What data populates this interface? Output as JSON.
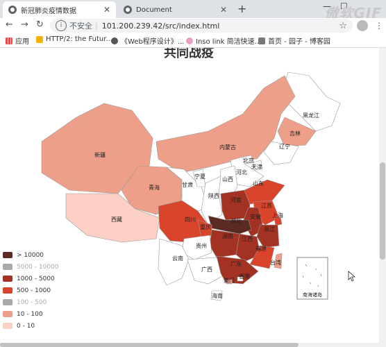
{
  "browser": {
    "tabs": [
      {
        "title": "新冠肺炎疫情数据",
        "active": true
      },
      {
        "title": "Document",
        "active": false
      }
    ],
    "watermark": "傲软GIF",
    "url_prefix": "不安全",
    "url": "101.200.239.42/src/index.html",
    "bookmarks": [
      {
        "label": "应用",
        "icon": "apps-grid-icon"
      },
      {
        "label": "HTTP/2: the Futur...",
        "icon": "page-icon"
      },
      {
        "label": "《Web程序设计》...",
        "icon": "globe-icon"
      },
      {
        "label": "Inso link 简洁快速...",
        "icon": "link-icon"
      },
      {
        "label": "首页 - 园子 - 博客园",
        "icon": "blog-icon"
      }
    ]
  },
  "map": {
    "title": "共同战疫",
    "legend": [
      {
        "label": "> 10000",
        "color": "#5b2a22",
        "enabled": true
      },
      {
        "label": "5000 - 10000",
        "color": "#a9a9a9",
        "enabled": false
      },
      {
        "label": "1000 - 5000",
        "color": "#a33223",
        "enabled": true
      },
      {
        "label": "500 - 1000",
        "color": "#d9442a",
        "enabled": true
      },
      {
        "label": "100 - 500",
        "color": "#a9a9a9",
        "enabled": false
      },
      {
        "label": "10 - 100",
        "color": "#ee9f8a",
        "enabled": true
      },
      {
        "label": "0 - 10",
        "color": "#fcd0c4",
        "enabled": true
      }
    ],
    "provinces": [
      {
        "name": "黑龙江",
        "level": "white"
      },
      {
        "name": "吉林",
        "level": "10-100"
      },
      {
        "name": "辽宁",
        "level": "white"
      },
      {
        "name": "内蒙古",
        "level": "10-100"
      },
      {
        "name": "北京",
        "level": "white"
      },
      {
        "name": "天津",
        "level": "white"
      },
      {
        "name": "河北",
        "level": "white"
      },
      {
        "name": "新疆",
        "level": "10-100"
      },
      {
        "name": "青海",
        "level": "10-100"
      },
      {
        "name": "西藏",
        "level": "0-10"
      },
      {
        "name": "甘肃",
        "level": "white"
      },
      {
        "name": "宁夏",
        "level": "white"
      },
      {
        "name": "山西",
        "level": "white"
      },
      {
        "name": "陕西",
        "level": "white"
      },
      {
        "name": "山东",
        "level": "500-1000"
      },
      {
        "name": "河南",
        "level": "1000-5000"
      },
      {
        "name": "江苏",
        "level": "500-1000"
      },
      {
        "name": "安徽",
        "level": "1000-5000"
      },
      {
        "name": "上海",
        "level": "500-1000"
      },
      {
        "name": "湖北",
        "level": ">10000"
      },
      {
        "name": "四川",
        "level": "500-1000"
      },
      {
        "name": "重庆",
        "level": "500-1000"
      },
      {
        "name": "浙江",
        "level": "1000-5000"
      },
      {
        "name": "湖南",
        "level": "1000-5000"
      },
      {
        "name": "江西",
        "level": "1000-5000"
      },
      {
        "name": "贵州",
        "level": "white"
      },
      {
        "name": "福建",
        "level": "500-1000"
      },
      {
        "name": "云南",
        "level": "white"
      },
      {
        "name": "广西",
        "level": "white"
      },
      {
        "name": "广东",
        "level": "1000-5000"
      },
      {
        "name": "台湾",
        "level": "10-100"
      },
      {
        "name": "澳门",
        "level": "10-100"
      },
      {
        "name": "香港",
        "level": "white"
      },
      {
        "name": "海南",
        "level": "white"
      }
    ],
    "inset_label": "南海诸岛"
  }
}
